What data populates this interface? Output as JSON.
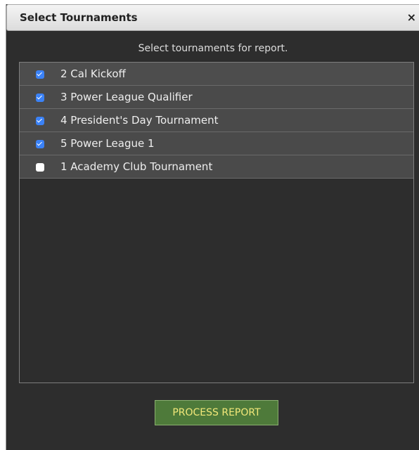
{
  "dialog": {
    "title": "Select Tournaments",
    "close_glyph": "×",
    "instructions": "Select tournaments for report."
  },
  "tournaments": [
    {
      "label": "2 Cal Kickoff",
      "checked": true
    },
    {
      "label": "3 Power League Qualifier",
      "checked": true
    },
    {
      "label": "4 President's Day Tournament",
      "checked": true
    },
    {
      "label": "5 Power League 1",
      "checked": true
    },
    {
      "label": "1 Academy Club Tournament",
      "checked": false
    }
  ],
  "actions": {
    "process_label": "PROCESS REPORT"
  },
  "colors": {
    "dialog_bg": "#2d2d2d",
    "row_bg": "#4a4a4a",
    "checkbox_checked": "#3b82f6",
    "button_bg": "#4e7a3a",
    "button_text": "#f2e879"
  }
}
